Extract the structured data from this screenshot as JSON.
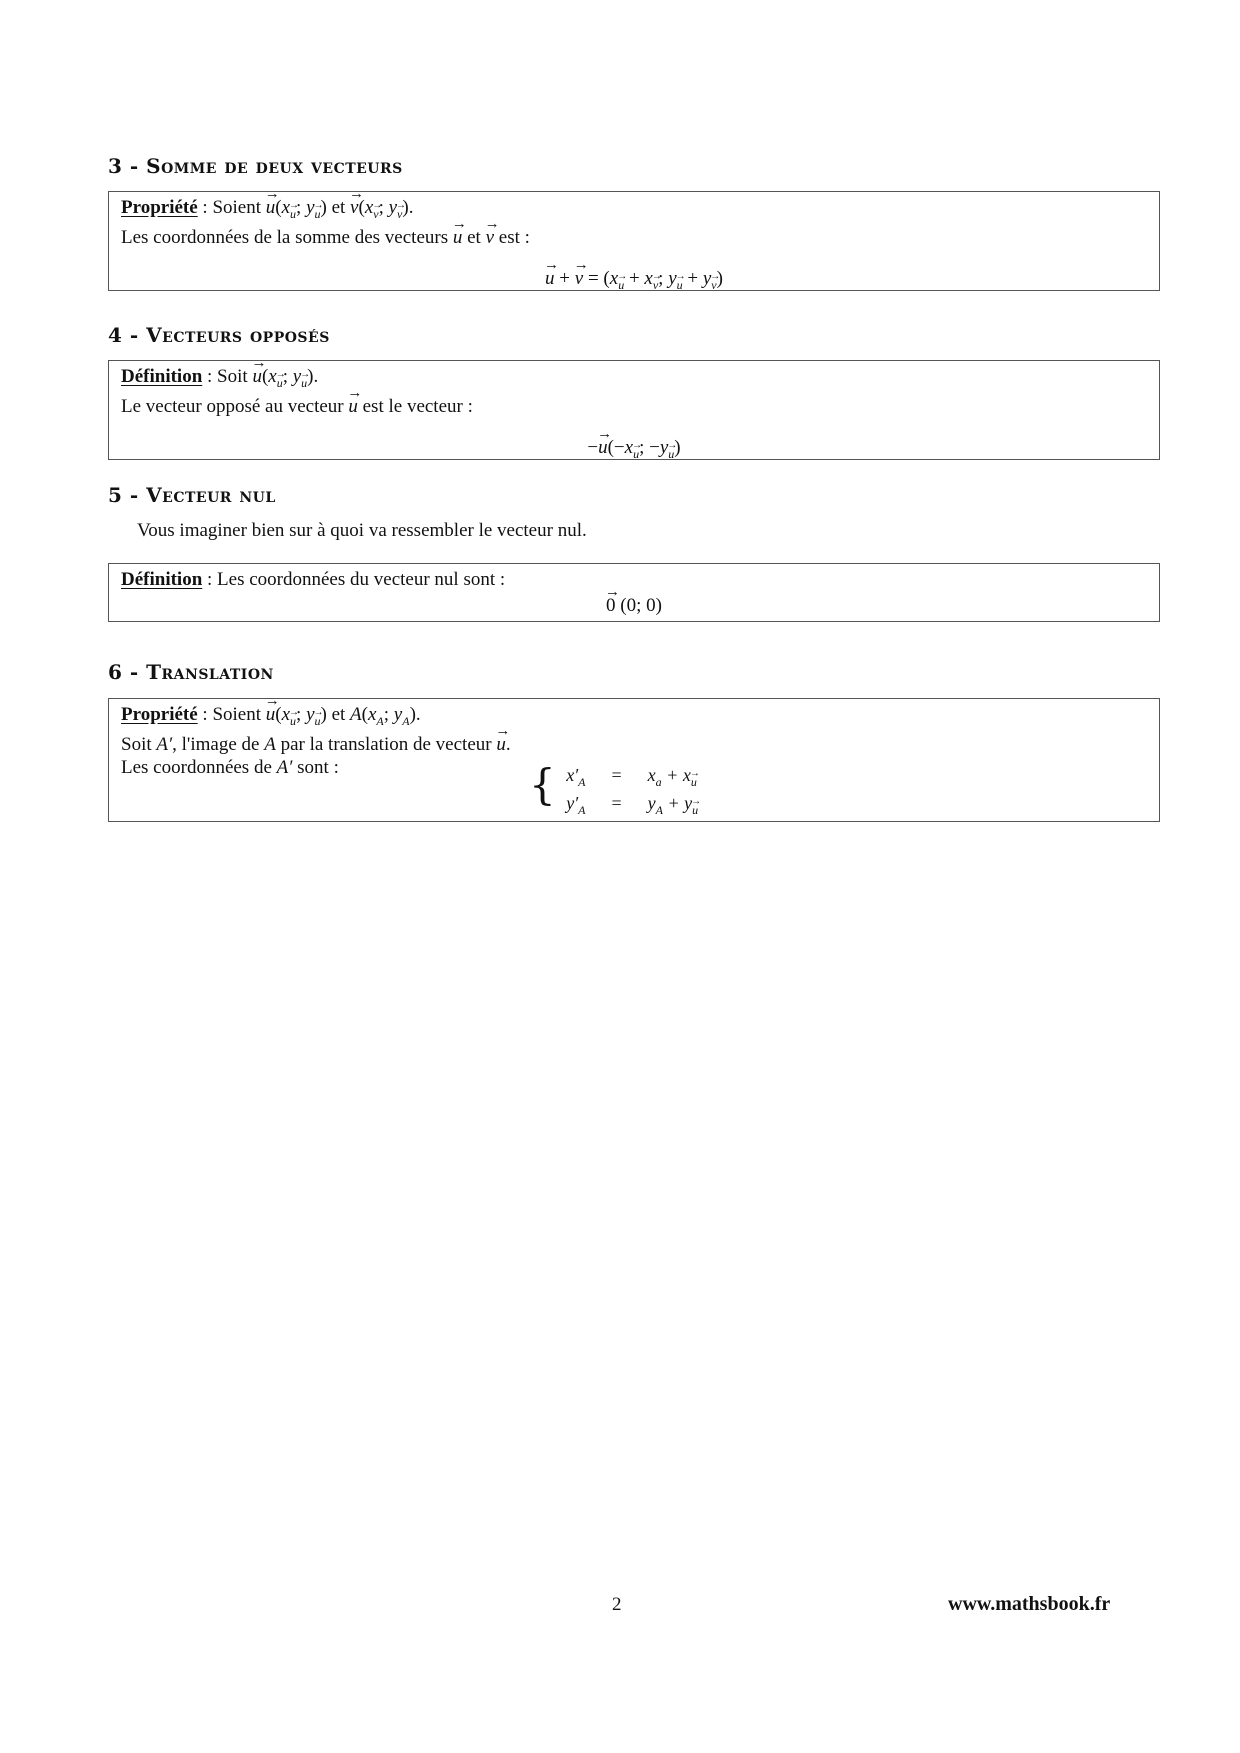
{
  "sections": [
    {
      "number": "3",
      "title": "3 - Somme de deux vecteurs",
      "box": {
        "label": "Propriété",
        "line1_text": " : Soient ",
        "line1_math": "u(x_u ; y_u) et v(x_v ; y_v).",
        "line2": "Les coordonnées de la somme des vecteurs u et v est :",
        "formula": "u + v = (x_u + x_v ; y_u + y_v)"
      }
    },
    {
      "number": "4",
      "title": "4 - Vecteurs opposés",
      "box": {
        "label": "Définition",
        "line1_text": " : Soit ",
        "line1_math": "u(x_u ; y_u).",
        "line2": "Le vecteur opposé au vecteur u est le vecteur :",
        "formula": "−u(−x_u ; −y_u)"
      }
    },
    {
      "number": "5",
      "title": "5 - Vecteur nul",
      "intro": "Vous imaginer bien sur à quoi va ressembler le vecteur nul.",
      "box": {
        "label": "Définition",
        "line1_text": " : Les coordonnées du vecteur nul sont :",
        "formula": "0(0; 0)"
      }
    },
    {
      "number": "6",
      "title": "6 - Translation",
      "box": {
        "label": "Propriété",
        "line1_text": " : Soient ",
        "line1_math": "u(x_u ; y_u) et A(x_A ; y_A).",
        "line2": "Soit A', l'image de A par la translation de vecteur u.",
        "line3": "Les coordonnées de A' sont :",
        "system": [
          {
            "lhs": "x'_A",
            "op": "=",
            "rhs": "x_a + x_u"
          },
          {
            "lhs": "y'_A",
            "op": "=",
            "rhs": "y_A + y_u"
          }
        ]
      }
    }
  ],
  "text": {
    "soient": "Soient",
    "soit": "Soit",
    "et": "et",
    "est": "est :",
    "line2_s3": "Les coordonnées de la somme des vecteurs",
    "line2_s4a": "Le vecteur opposé au vecteur",
    "line2_s4b": "est le vecteur :",
    "line2_s6a": "Soit",
    "line2_s6b": ", l'image de",
    "line2_s6c": "par la translation de vecteur",
    "line3_s6a": "Les coordonnées de",
    "line3_s6b": "sont :",
    "u": "u",
    "v": "v",
    "x": "x",
    "y": "y",
    "A": "A",
    "zero": "0",
    "zero_coords": "(0; 0)"
  },
  "footer": {
    "page_number": "2",
    "website": "www.mathsbook.fr"
  }
}
